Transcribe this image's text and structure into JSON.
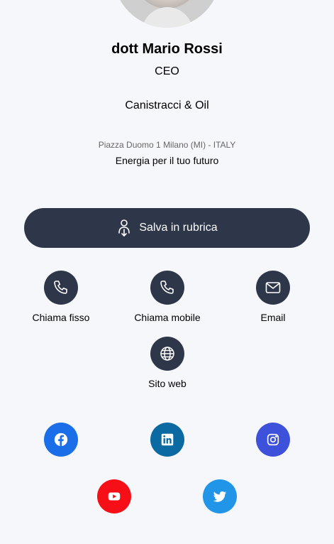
{
  "profile": {
    "name": "dott Mario Rossi",
    "role": "CEO",
    "company": "Canistracci & Oil",
    "address": "Piazza Duomo 1 Milano (MI) - ITALY",
    "slogan": "Energia per il tuo futuro"
  },
  "save_button": {
    "label": "Salva in rubrica",
    "icon": "add-contact-icon"
  },
  "actions": [
    {
      "label": "Chiama fisso",
      "icon": "phone-icon"
    },
    {
      "label": "Chiama mobile",
      "icon": "phone-icon"
    },
    {
      "label": "Email",
      "icon": "mail-icon"
    },
    {
      "label": "Sito web",
      "icon": "globe-icon"
    }
  ],
  "social": [
    {
      "name": "facebook",
      "color": "#1a6ee8"
    },
    {
      "name": "linkedin",
      "color": "#0b6aa2"
    },
    {
      "name": "instagram",
      "color": "#3d51da"
    },
    {
      "name": "youtube",
      "color": "#f70f17"
    },
    {
      "name": "twitter",
      "color": "#2196e8"
    }
  ],
  "colors": {
    "background": "#f6f7fa",
    "primary": "#2e3749"
  }
}
